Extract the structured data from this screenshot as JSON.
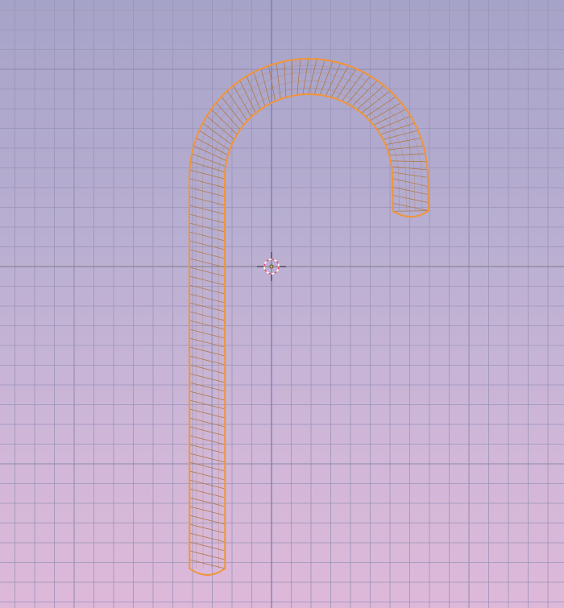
{
  "viewport": {
    "view": "3d-viewport",
    "shading": "wireframe",
    "grid": true,
    "axis_lines": [
      "x-axis",
      "y-axis"
    ]
  },
  "colors": {
    "background_top": "#a6a3c8",
    "background_bottom": "#deb8d9",
    "grid_minor": "#9a94b8",
    "grid_major": "#8f8aad",
    "x_axis": "#8a8696",
    "y_axis": "#6e78b8",
    "selection_outline": "#f0953a",
    "wire": "#b07a4a",
    "cursor_red": "#e0506a",
    "cursor_white": "#ffffff"
  },
  "object": {
    "name": "candy-cane-mesh",
    "selected": true
  },
  "cursor": {
    "name": "3d-cursor-icon"
  }
}
